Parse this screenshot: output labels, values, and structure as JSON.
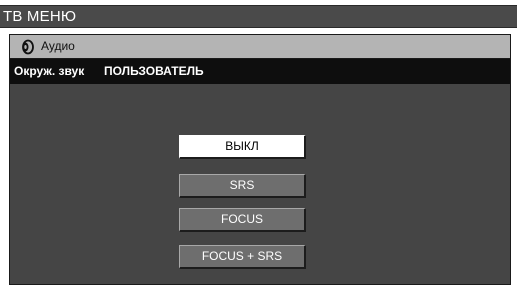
{
  "header": {
    "title": "ТВ МЕНЮ"
  },
  "panel": {
    "section_icon": "speaker-icon",
    "section_label": "Аудио",
    "setting": {
      "label": "Окруж. звук",
      "value": "ПОЛЬЗОВАТЕЛЬ"
    },
    "options": [
      {
        "label": "ВЫКЛ",
        "selected": true
      },
      {
        "label": "SRS",
        "selected": false
      },
      {
        "label": "FOCUS",
        "selected": false
      },
      {
        "label": "FOCUS + SRS",
        "selected": false
      }
    ]
  },
  "colors": {
    "title_bar": "#4a4a4a",
    "panel_bg": "#454545",
    "panel_header": "#b4b4b4",
    "setting_row": "#0e0e0e",
    "option_bg": "#6e6e6e",
    "option_selected_bg": "#ffffff"
  }
}
